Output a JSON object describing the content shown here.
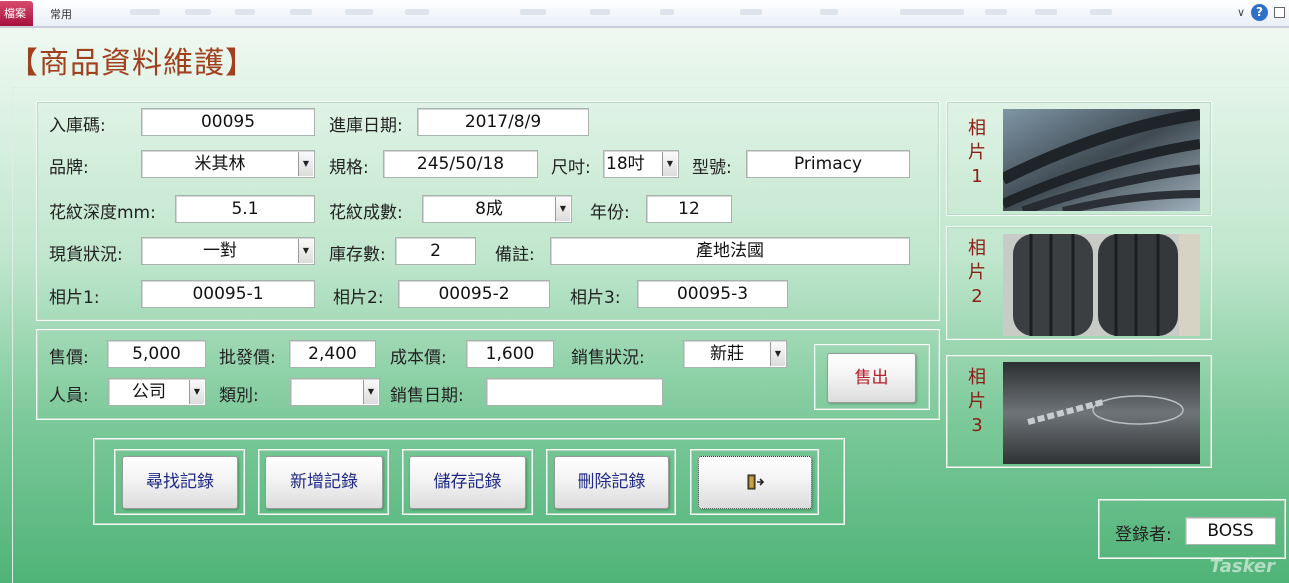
{
  "ribbon": {
    "file_tab": "檔案",
    "home_tab": "常用"
  },
  "form_title": "【商品資料維護】",
  "details": {
    "stock_code_label": "入庫碼:",
    "stock_code": "00095",
    "stock_date_label": "進庫日期:",
    "stock_date": "2017/8/9",
    "brand_label": "品牌:",
    "brand": "米其林",
    "spec_label": "規格:",
    "spec": "245/50/18",
    "size_label": "尺吋:",
    "size": "18吋",
    "model_label": "型號:",
    "model": "Primacy",
    "tread_depth_label": "花紋深度mm:",
    "tread_depth": "5.1",
    "tread_pct_label": "花紋成數:",
    "tread_pct": "8成",
    "year_label": "年份:",
    "year": "12",
    "status_label": "現貨狀況:",
    "status": "一對",
    "stock_qty_label": "庫存數:",
    "stock_qty": "2",
    "remark_label": "備註:",
    "remark": "產地法國",
    "photo1_label": "相片1:",
    "photo1": "00095-1",
    "photo2_label": "相片2:",
    "photo2": "00095-2",
    "photo3_label": "相片3:",
    "photo3": "00095-3"
  },
  "sales": {
    "price_label": "售價:",
    "price": "5,000",
    "wholesale_label": "批發價:",
    "wholesale": "2,400",
    "cost_label": "成本價:",
    "cost": "1,600",
    "sale_status_label": "銷售狀況:",
    "sale_status": "新莊",
    "staff_label": "人員:",
    "staff": "公司",
    "category_label": "類別:",
    "category": "",
    "sale_date_label": "銷售日期:",
    "sale_date": "",
    "sold_button": "售出"
  },
  "actions": {
    "find": "尋找記錄",
    "add": "新增記錄",
    "save": "儲存記錄",
    "delete": "刪除記錄",
    "exit_icon": "exit-door-icon"
  },
  "photos": [
    {
      "label": [
        "相",
        "片",
        "1"
      ]
    },
    {
      "label": [
        "相",
        "片",
        "2"
      ]
    },
    {
      "label": [
        "相",
        "片",
        "3"
      ]
    }
  ],
  "login": {
    "label": "登錄者:",
    "user": "BOSS"
  },
  "watermark": "Tasker",
  "colors": {
    "title": "#a1401e",
    "button_text": "#1f2a86",
    "photo_label": "#8b1e12",
    "file_tab": "#b81d46"
  }
}
